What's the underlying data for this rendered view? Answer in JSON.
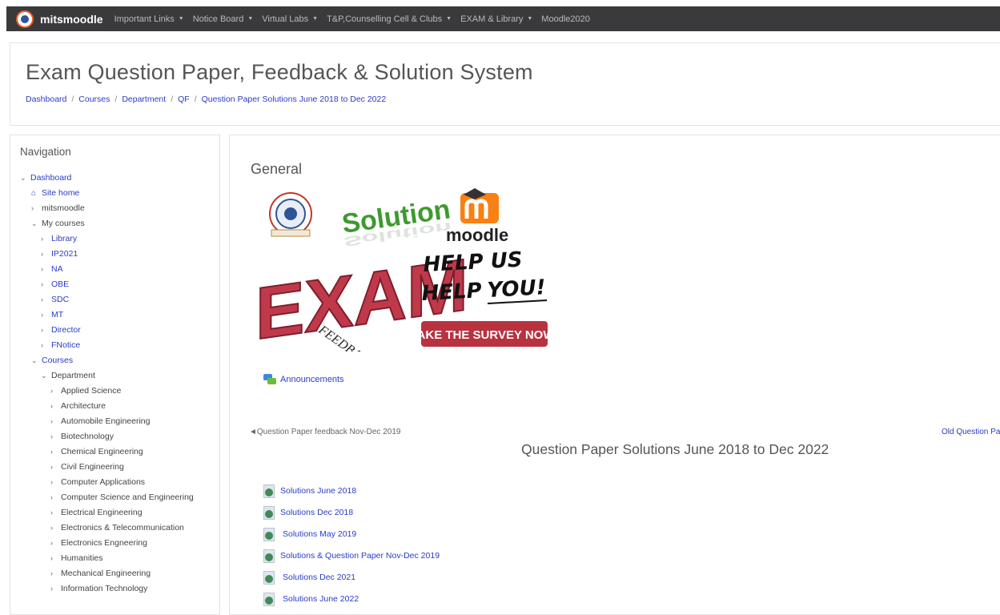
{
  "navbar": {
    "brand": "mitsmoodle",
    "items": [
      {
        "label": "Important Links",
        "dropdown": true
      },
      {
        "label": "Notice Board",
        "dropdown": true
      },
      {
        "label": "Virtual Labs",
        "dropdown": true
      },
      {
        "label": "T&P,Counselling Cell & Clubs",
        "dropdown": true
      },
      {
        "label": "EXAM & Library",
        "dropdown": true
      },
      {
        "label": "Moodle2020",
        "dropdown": false
      }
    ]
  },
  "header": {
    "title": "Exam Question Paper, Feedback & Solution System",
    "breadcrumb": [
      "Dashboard",
      "Courses",
      "Department",
      "QF",
      "Question Paper Solutions June 2018 to Dec 2022"
    ]
  },
  "navigation": {
    "title": "Navigation",
    "tree": [
      {
        "label": "Dashboard",
        "level": 0,
        "expanded": true,
        "link": true,
        "icon": "chevron-down-icon"
      },
      {
        "label": "Site home",
        "level": 1,
        "link": true,
        "icon": "home-icon"
      },
      {
        "label": "mitsmoodle",
        "level": 1,
        "link": false,
        "icon": "chevron-right-icon"
      },
      {
        "label": "My courses",
        "level": 1,
        "link": false,
        "icon": "chevron-down-icon"
      },
      {
        "label": "Library",
        "level": 2,
        "link": true,
        "icon": "chevron-right-icon"
      },
      {
        "label": "IP2021",
        "level": 2,
        "link": true,
        "icon": "chevron-right-icon"
      },
      {
        "label": "NA",
        "level": 2,
        "link": true,
        "icon": "chevron-right-icon"
      },
      {
        "label": "OBE",
        "level": 2,
        "link": true,
        "icon": "chevron-right-icon"
      },
      {
        "label": "SDC",
        "level": 2,
        "link": true,
        "icon": "chevron-right-icon"
      },
      {
        "label": "MT",
        "level": 2,
        "link": true,
        "icon": "chevron-right-icon"
      },
      {
        "label": "Director",
        "level": 2,
        "link": true,
        "icon": "chevron-right-icon"
      },
      {
        "label": "FNotice",
        "level": 2,
        "link": true,
        "icon": "chevron-right-icon"
      },
      {
        "label": "Courses",
        "level": 1,
        "link": true,
        "icon": "chevron-down-icon"
      },
      {
        "label": "Department",
        "level": 2,
        "link": false,
        "icon": "chevron-down-icon"
      },
      {
        "label": "Applied Science",
        "level": 3,
        "link": false,
        "icon": "chevron-right-icon"
      },
      {
        "label": "Architecture",
        "level": 3,
        "link": false,
        "icon": "chevron-right-icon"
      },
      {
        "label": "Automobile Engineering",
        "level": 3,
        "link": false,
        "icon": "chevron-right-icon"
      },
      {
        "label": "Biotechnology",
        "level": 3,
        "link": false,
        "icon": "chevron-right-icon"
      },
      {
        "label": "Chemical Engineering",
        "level": 3,
        "link": false,
        "icon": "chevron-right-icon"
      },
      {
        "label": "Civil Engineering",
        "level": 3,
        "link": false,
        "icon": "chevron-right-icon"
      },
      {
        "label": "Computer Applications",
        "level": 3,
        "link": false,
        "icon": "chevron-right-icon"
      },
      {
        "label": "Computer Science and Engineering",
        "level": 3,
        "link": false,
        "icon": "chevron-right-icon"
      },
      {
        "label": "Electrical Engineering",
        "level": 3,
        "link": false,
        "icon": "chevron-right-icon"
      },
      {
        "label": "Electronics & Telecommunication",
        "level": 3,
        "link": false,
        "icon": "chevron-right-icon"
      },
      {
        "label": "Electronics Engneering",
        "level": 3,
        "link": false,
        "icon": "chevron-right-icon"
      },
      {
        "label": "Humanities",
        "level": 3,
        "link": false,
        "icon": "chevron-right-icon"
      },
      {
        "label": "Mechanical Engineering",
        "level": 3,
        "link": false,
        "icon": "chevron-right-icon"
      },
      {
        "label": "Information Technology",
        "level": 3,
        "link": false,
        "icon": "chevron-right-icon"
      }
    ]
  },
  "main": {
    "general_heading": "General",
    "banner": {
      "solution_text": "Solution",
      "exam_text": "EXAM",
      "feedback_text": "FEEDBACK",
      "moodle_text": "moodle",
      "help_line1": "HELP US",
      "help_line2": "HELP",
      "help_line2b": "YOU!",
      "survey_button": "TAKE THE SURVEY NOW!"
    },
    "announcements": "Announcements",
    "prev_section": "Question Paper feedback Nov-Dec 2019",
    "next_section": "Old Question Pap",
    "section_title": "Question Paper Solutions June 2018 to Dec 2022",
    "resources": [
      "Solutions June 2018",
      "Solutions Dec 2018",
      "Solutions May 2019",
      "Solutions & Question Paper Nov-Dec 2019",
      "Solutions Dec 2021",
      "Solutions June 2022"
    ]
  },
  "colors": {
    "navbar": "#3a3a3c",
    "link": "#2a3cc6",
    "exam_red": "#c0394b",
    "survey_red": "#b8323f",
    "moodle_orange": "#f98012",
    "solution_green": "#3e9a2f"
  }
}
